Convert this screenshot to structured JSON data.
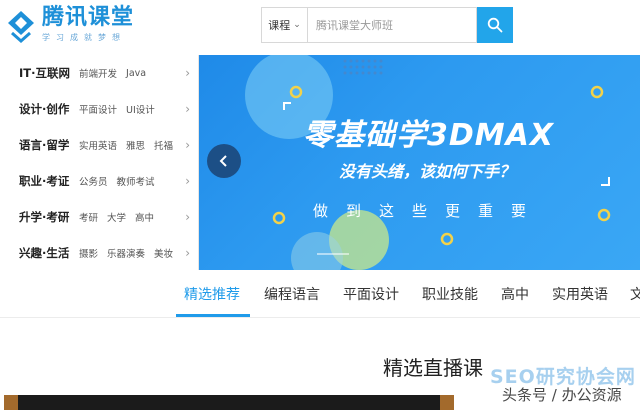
{
  "header": {
    "logo_title": "腾讯课堂",
    "logo_sub": "学习成就梦想",
    "search": {
      "type_label": "课程",
      "placeholder": "腾讯课堂大师班"
    }
  },
  "sidebar": {
    "categories": [
      {
        "main": "IT·互联网",
        "subs": [
          "前端开发",
          "Java"
        ]
      },
      {
        "main": "设计·创作",
        "subs": [
          "平面设计",
          "UI设计"
        ]
      },
      {
        "main": "语言·留学",
        "subs": [
          "实用英语",
          "雅思",
          "托福"
        ]
      },
      {
        "main": "职业·考证",
        "subs": [
          "公务员",
          "教师考试"
        ]
      },
      {
        "main": "升学·考研",
        "subs": [
          "考研",
          "大学",
          "高中"
        ]
      },
      {
        "main": "兴趣·生活",
        "subs": [
          "摄影",
          "乐器演奏",
          "美妆"
        ]
      }
    ]
  },
  "banner": {
    "main": "零基础学3DMAX",
    "sub": "没有头绪，该如何下手？",
    "tag": "做到这些更重要"
  },
  "tabs": {
    "items": [
      "精选推荐",
      "编程语言",
      "平面设计",
      "职业技能",
      "高中",
      "实用英语",
      "文"
    ],
    "active_index": 0
  },
  "section": {
    "title": "精选直播课"
  },
  "watermark": {
    "top": "SEO研究协会网",
    "bottom": "头条号 / 办公资源"
  },
  "colors": {
    "accent": "#1f9bea",
    "banner_bg": "#2d9af0",
    "search_button": "#22a5ea"
  }
}
